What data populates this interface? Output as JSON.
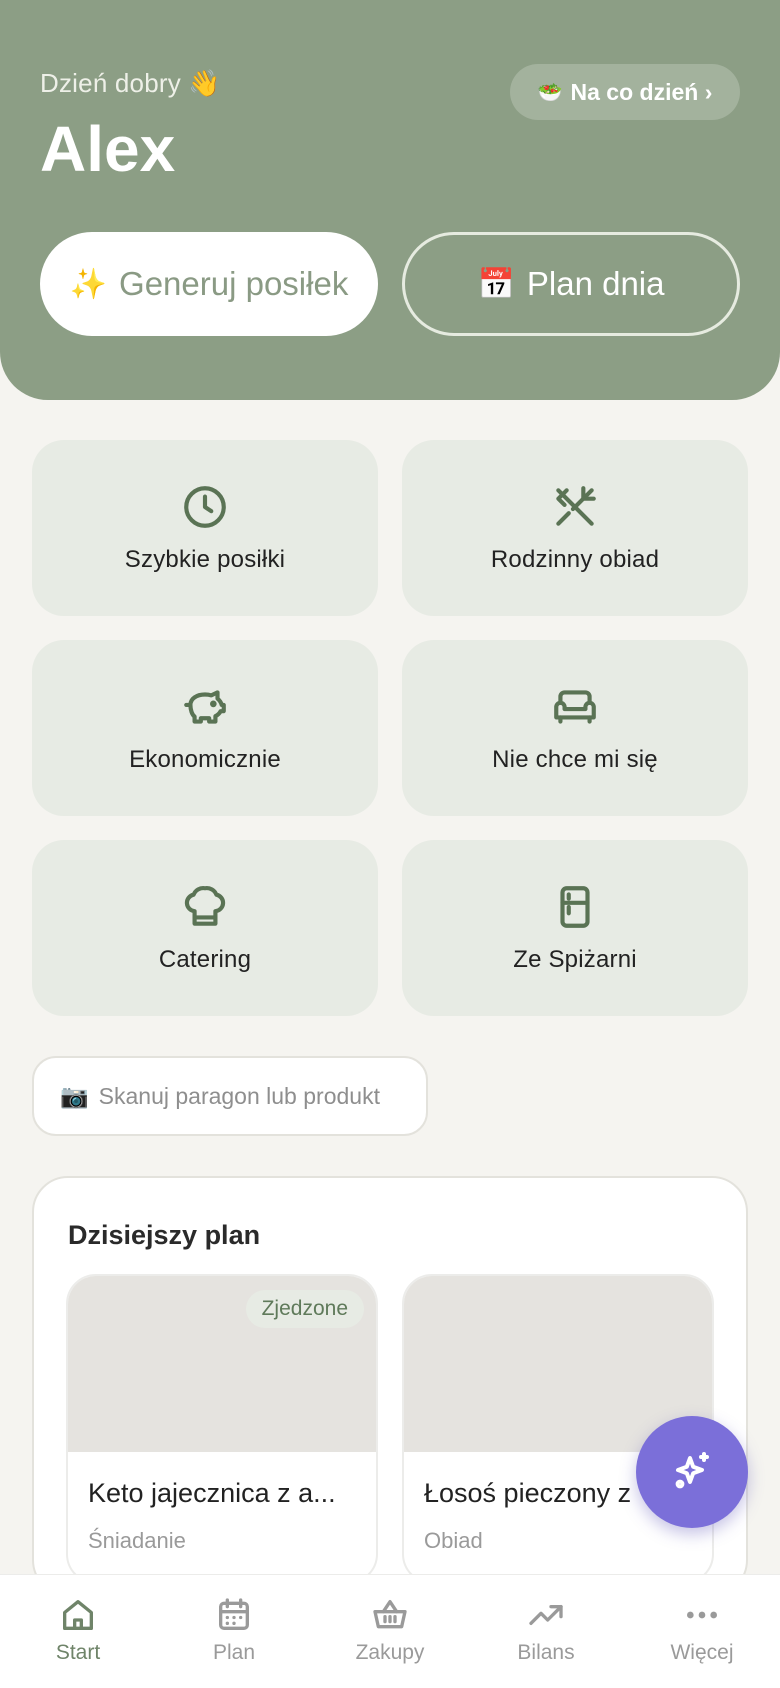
{
  "header": {
    "greeting": "Dzień dobry",
    "greeting_emoji": "👋",
    "username": "Alex",
    "pill_emoji": "🥗",
    "pill_label": "Na co dzień ›",
    "generate_emoji": "✨",
    "generate_label": "Generuj posiłek",
    "plan_emoji": "📅",
    "plan_label": "Plan dnia"
  },
  "tiles": [
    {
      "label": "Szybkie posiłki",
      "icon": "clock-icon"
    },
    {
      "label": "Rodzinny obiad",
      "icon": "fork-knife-icon"
    },
    {
      "label": "Ekonomicznie",
      "icon": "piggy-bank-icon"
    },
    {
      "label": "Nie chce mi się",
      "icon": "sofa-icon"
    },
    {
      "label": "Catering",
      "icon": "chef-hat-icon"
    },
    {
      "label": "Ze Spiżarni",
      "icon": "fridge-icon"
    }
  ],
  "scan": {
    "emoji": "📷",
    "label": "Skanuj paragon lub produkt"
  },
  "plan": {
    "title": "Dzisiejszy plan",
    "meals": [
      {
        "name": "Keto jajecznica z a...",
        "type": "Śniadanie",
        "badge": "Zjedzone"
      },
      {
        "name": "Łosoś pieczony z",
        "type": "Obiad"
      }
    ]
  },
  "nav": {
    "items": [
      {
        "label": "Start",
        "icon": "home-icon"
      },
      {
        "label": "Plan",
        "icon": "calendar-icon"
      },
      {
        "label": "Zakupy",
        "icon": "basket-icon"
      },
      {
        "label": "Bilans",
        "icon": "trend-icon"
      },
      {
        "label": "Więcej",
        "icon": "more-icon"
      }
    ]
  },
  "colors": {
    "header_bg": "#8c9e85",
    "tile_bg": "#e7ebe4",
    "icon_green": "#5a7354",
    "fab": "#7b6fd9",
    "nav_active": "#6f8469"
  }
}
